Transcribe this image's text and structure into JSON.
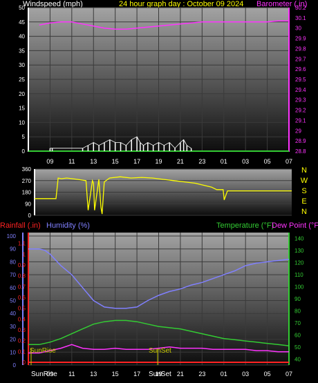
{
  "top": {
    "windspeed_label": "Windspeed (mph)",
    "title": "24 hour graph day : October 09 2024",
    "barometer_label": "Barometer (.in)",
    "wind_ticks": [
      0,
      5,
      10,
      15,
      20,
      25,
      30,
      35,
      40,
      45,
      50
    ],
    "baro_ticks": [
      "28.8",
      "28.9",
      "29",
      "29.1",
      "29.2",
      "29.3",
      "29.4",
      "29.5",
      "29.6",
      "29.7",
      "29.8",
      "29.9",
      "30",
      "30.1",
      "30.2"
    ]
  },
  "mid": {
    "dir_ticks": [
      0,
      90,
      180,
      270,
      360
    ],
    "compass": [
      "N",
      "W",
      "S",
      "E",
      "N"
    ]
  },
  "bottom": {
    "rainfall_label": "Rainfall (.in)",
    "humidity_label": "Humidity (%)",
    "temperature_label": "Temperature (°F)",
    "dewpoint_label": "Dew Point (°F)",
    "rain_ticks": [
      "0",
      "0.1",
      "0.2",
      "0.3",
      "0.4",
      "0.5",
      "0.6",
      "0.7",
      "0.8",
      "0.9",
      "1",
      "1.1"
    ],
    "humidity_ticks": [
      0,
      10,
      20,
      30,
      40,
      50,
      60,
      70,
      80,
      90,
      100
    ],
    "temp_ticks": [
      40,
      50,
      60,
      70,
      80,
      90,
      100,
      110,
      120,
      130,
      140
    ],
    "sunrise_label": "SunRise",
    "sunset_label": "SunSet",
    "sunrise_axis": "SunRise",
    "sunset_axis": "SunSet"
  },
  "time_ticks": [
    "09",
    "11",
    "13",
    "15",
    "17",
    "19",
    "21",
    "23",
    "01",
    "03",
    "05",
    "07"
  ],
  "colors": {
    "windspeed": "#ffffff",
    "barometer": "#ff33ff",
    "wind_dir": "#ffff00",
    "rainfall": "#ff2222",
    "humidity": "#8080ff",
    "temperature": "#33cc33",
    "dewpoint": "#ff33ff",
    "title": "#ffff00"
  },
  "chart_data": [
    {
      "type": "line",
      "title": "24 hour graph day : October 09 2024",
      "xlabel": "",
      "ylabel": "Windspeed (mph)",
      "ylim": [
        0,
        50
      ],
      "y2label": "Barometer (.in)",
      "y2lim": [
        28.8,
        30.2
      ],
      "series": [
        {
          "name": "Barometer (.in)",
          "axis": "right",
          "x": [
            8,
            9,
            10,
            11,
            12,
            13,
            14,
            15,
            16,
            17,
            18,
            19,
            20,
            21,
            22,
            23,
            24,
            25,
            26,
            27,
            28,
            29,
            30,
            31
          ],
          "values": [
            30.03,
            30.05,
            30.06,
            30.06,
            30.04,
            30.02,
            30.0,
            29.99,
            29.99,
            30.0,
            30.01,
            30.02,
            30.03,
            30.04,
            30.05,
            30.06,
            30.06,
            30.06,
            30.06,
            30.06,
            30.06,
            30.06,
            30.07,
            30.07
          ]
        },
        {
          "name": "Windspeed (mph)",
          "axis": "left",
          "x": [
            9.0,
            9.2,
            12.0,
            12.5,
            13.0,
            13.5,
            14.0,
            14.5,
            15.0,
            15.5,
            16.0,
            16.5,
            17.0,
            17.3,
            17.6,
            18.0,
            18.5,
            19.0,
            19.5,
            20.0,
            20.5,
            21.0,
            21.3,
            21.6,
            22.0
          ],
          "values": [
            1,
            1,
            1,
            2,
            3,
            2,
            3,
            4,
            3,
            3,
            2,
            4,
            5,
            3,
            2,
            3,
            2,
            3,
            2,
            3,
            1,
            3,
            4,
            2,
            1
          ]
        }
      ]
    },
    {
      "type": "line",
      "title": "",
      "ylabel": "",
      "ylim": [
        0,
        360
      ],
      "series": [
        {
          "name": "",
          "x": [
            7.0,
            8.0,
            9.0,
            9.2,
            9.5,
            10.0,
            11.0,
            11.8,
            12.0,
            12.4,
            12.5,
            12.6,
            13.0,
            13.2,
            13.3,
            13.5,
            14.0,
            15.0,
            16.0,
            17.0,
            18.0,
            19.0,
            20.0,
            21.0,
            22.0,
            23.0,
            23.5,
            24.0,
            24.6,
            24.7,
            25.0,
            26.0,
            27.0,
            28.0,
            29.0,
            30.0,
            31.0
          ],
          "values": [
            130,
            130,
            130,
            290,
            285,
            290,
            280,
            270,
            40,
            270,
            250,
            40,
            280,
            60,
            10,
            260,
            290,
            300,
            290,
            295,
            290,
            280,
            270,
            260,
            250,
            230,
            220,
            200,
            200,
            120,
            190,
            190,
            190,
            190,
            190,
            190,
            190
          ]
        }
      ]
    },
    {
      "type": "line",
      "title": "",
      "ylabel": "Humidity (%)",
      "ylim": [
        0,
        100
      ],
      "y2label": "Temperature (°F)",
      "y2lim": [
        35,
        145
      ],
      "y3label": "Rainfall (.in)",
      "y3lim": [
        0,
        1.2
      ],
      "series": [
        {
          "name": "Humidity (%)",
          "axis": "left",
          "x": [
            7,
            8,
            8.5,
            9,
            10,
            11,
            12,
            13,
            14,
            15,
            16,
            17,
            18,
            19,
            20,
            21,
            22,
            23,
            24,
            25,
            26,
            27,
            28,
            29,
            30,
            31
          ],
          "values": [
            90,
            90,
            89,
            86,
            77,
            70,
            60,
            50,
            45,
            44,
            44,
            45,
            50,
            54,
            57,
            59,
            62,
            64,
            67,
            70,
            73,
            77,
            79,
            80,
            81,
            82
          ]
        },
        {
          "name": "Temperature (°F)",
          "axis": "right",
          "x": [
            7,
            8,
            9,
            10,
            11,
            12,
            13,
            14,
            15,
            16,
            17,
            18,
            19,
            20,
            21,
            22,
            23,
            24,
            25,
            26,
            27,
            28,
            29,
            30,
            31
          ],
          "values": [
            52,
            52,
            54,
            57,
            61,
            65,
            69,
            71,
            72,
            72,
            71,
            69,
            67,
            66,
            65,
            63,
            61,
            59,
            57,
            56,
            55,
            54,
            53,
            52,
            51
          ]
        },
        {
          "name": "Dew Point (°F)",
          "axis": "right",
          "x": [
            7,
            8,
            9,
            10,
            11,
            12,
            13,
            14,
            15,
            16,
            17,
            18,
            19,
            20,
            21,
            22,
            23,
            24,
            25,
            26,
            27,
            28,
            29,
            30,
            31
          ],
          "values": [
            45,
            45,
            47,
            49,
            52,
            49,
            48,
            48,
            49,
            48,
            48,
            48,
            49,
            50,
            49,
            49,
            49,
            48,
            48,
            48,
            48,
            47,
            47,
            46,
            46
          ]
        },
        {
          "name": "Rainfall (.in)",
          "axis": "far-left",
          "x": [
            7,
            31
          ],
          "values": [
            0,
            0
          ]
        }
      ]
    }
  ]
}
